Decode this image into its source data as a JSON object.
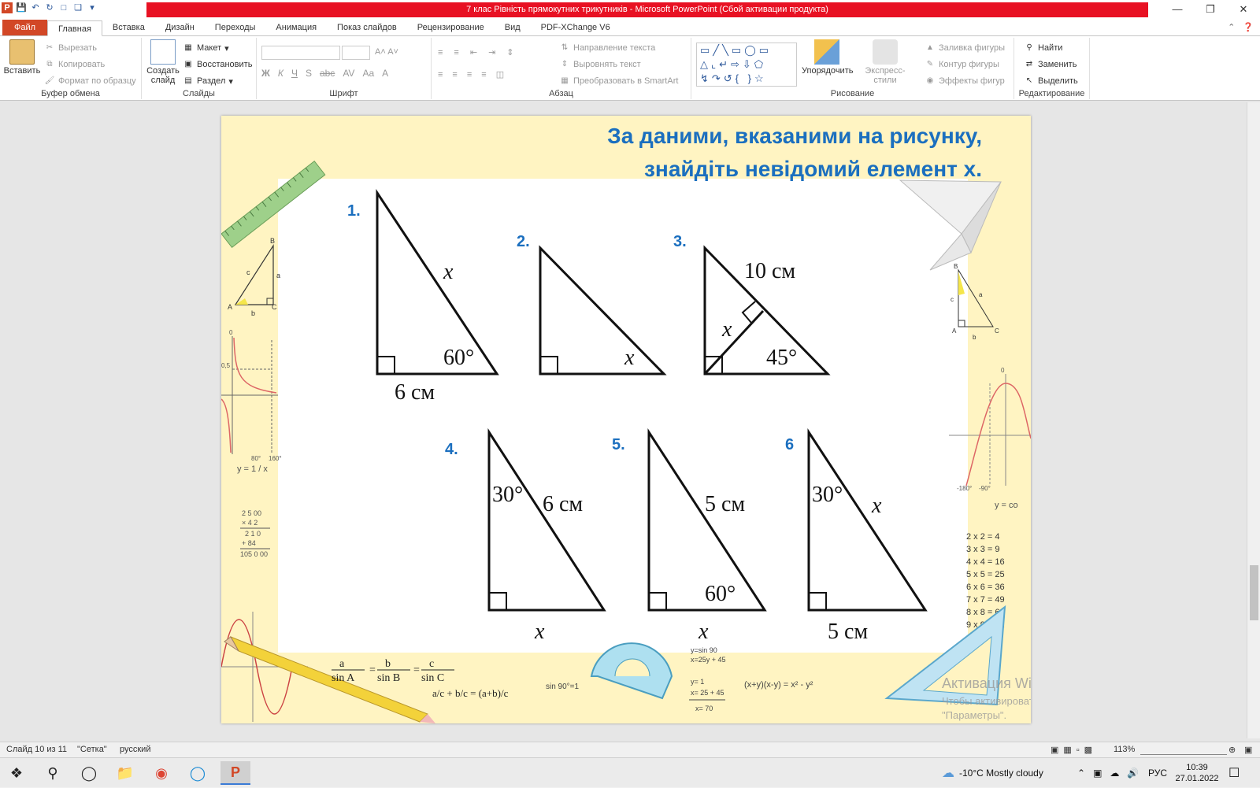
{
  "window": {
    "title": "7 клас Рівність прямокутних трикутників  -  Microsoft PowerPoint (Сбой активации продукта)"
  },
  "tabs": [
    {
      "label": "Файл"
    },
    {
      "label": "Главная"
    },
    {
      "label": "Вставка"
    },
    {
      "label": "Дизайн"
    },
    {
      "label": "Переходы"
    },
    {
      "label": "Анимация"
    },
    {
      "label": "Показ слайдов"
    },
    {
      "label": "Рецензирование"
    },
    {
      "label": "Вид"
    },
    {
      "label": "PDF-XChange V6"
    }
  ],
  "ribbon": {
    "clipboard": {
      "paste": "Вставить",
      "cut": "Вырезать",
      "copy": "Копировать",
      "format": "Формат по образцу",
      "label": "Буфер обмена"
    },
    "slides": {
      "create_line1": "Создать",
      "create_line2": "слайд",
      "layout": "Макет",
      "reset": "Восстановить",
      "section": "Раздел",
      "label": "Слайды"
    },
    "font": {
      "label": "Шрифт",
      "bold": "Ж",
      "italic": "К",
      "underline": "Ч",
      "strike": "abc",
      "shadow": "S",
      "spacing": "AV",
      "case": "Aa",
      "color": "A"
    },
    "paragraph": {
      "label": "Абзац",
      "text_dir": "Направление текста",
      "align_text": "Выровнять текст",
      "smartart": "Преобразовать в SmartArt"
    },
    "drawing": {
      "label": "Рисование",
      "arrange": "Упорядочить",
      "styles": "Экспресс-стили",
      "fill": "Заливка фигуры",
      "outline": "Контур фигуры",
      "effects": "Эффекты фигур"
    },
    "editing": {
      "label": "Редактирование",
      "find": "Найти",
      "replace": "Заменить",
      "select": "Выделить"
    }
  },
  "slide": {
    "title_line1": "За даними, вказаними на рисунку,",
    "title_line2": "знайдіть невідомий елемент х.",
    "problems": [
      {
        "num": "1.",
        "labels": [
          "x",
          "60°",
          "6 см"
        ]
      },
      {
        "num": "2.",
        "labels": [
          "x"
        ]
      },
      {
        "num": "3.",
        "labels": [
          "10 см",
          "x",
          "45°"
        ]
      },
      {
        "num": "4.",
        "labels": [
          "30°",
          "6 см",
          "x"
        ]
      },
      {
        "num": "5.",
        "labels": [
          "5 см",
          "60°",
          "x"
        ]
      },
      {
        "num": "6",
        "labels": [
          "30°",
          "x",
          "5 см"
        ]
      }
    ],
    "decor": {
      "left_ABC": [
        "B",
        "A",
        "C",
        "c",
        "a",
        "b"
      ],
      "hyperbola": "y = 1 / x",
      "hyperbola_ticks": [
        "0",
        "80°",
        "160°",
        "0,5"
      ],
      "mult_lines": [
        "2 5 00",
        "×  4 2",
        "2 1 0",
        "+ 84",
        "105 0 00"
      ],
      "sine_law": [
        "a",
        "sin A",
        "b",
        "sin B",
        "c",
        "sin C"
      ],
      "frac_sum": "a/c + b/c = (a+b)/c",
      "sin_note": "sin 90°=1",
      "system1": [
        "y=sin 90",
        "x=25y + 45"
      ],
      "system2": [
        "y= 1",
        "x= 25 + 45",
        "x= 70"
      ],
      "identity": "(x+y)(x-y) = x² - y²",
      "right_ABC": [
        "B",
        "A",
        "C",
        "c",
        "a",
        "b"
      ],
      "cos_label": "y = co",
      "cos_ticks": [
        "-180°",
        "-90°",
        "0"
      ],
      "squares": [
        "2 x 2 = 4",
        "3 x 3 = 9",
        "4 x 4 = 16",
        "5 x 5 = 25",
        "6 x 6 = 36",
        "7 x 7 = 49",
        "8 x 8 = 64",
        "9 x 9 = 81"
      ],
      "activation_title": "Активация Windows",
      "activation_sub1": "Чтобы активировать Windows, перейдите в раздел",
      "activation_sub2": "\"Параметры\"."
    }
  },
  "status": {
    "slide": "Слайд 10 из 11",
    "theme": "\"Сетка\"",
    "lang": "русский",
    "zoom": "113%"
  },
  "taskbar": {
    "weather": "-10°C  Mostly cloudy",
    "lang": "РУС",
    "time": "10:39",
    "date": "27.01.2022"
  }
}
